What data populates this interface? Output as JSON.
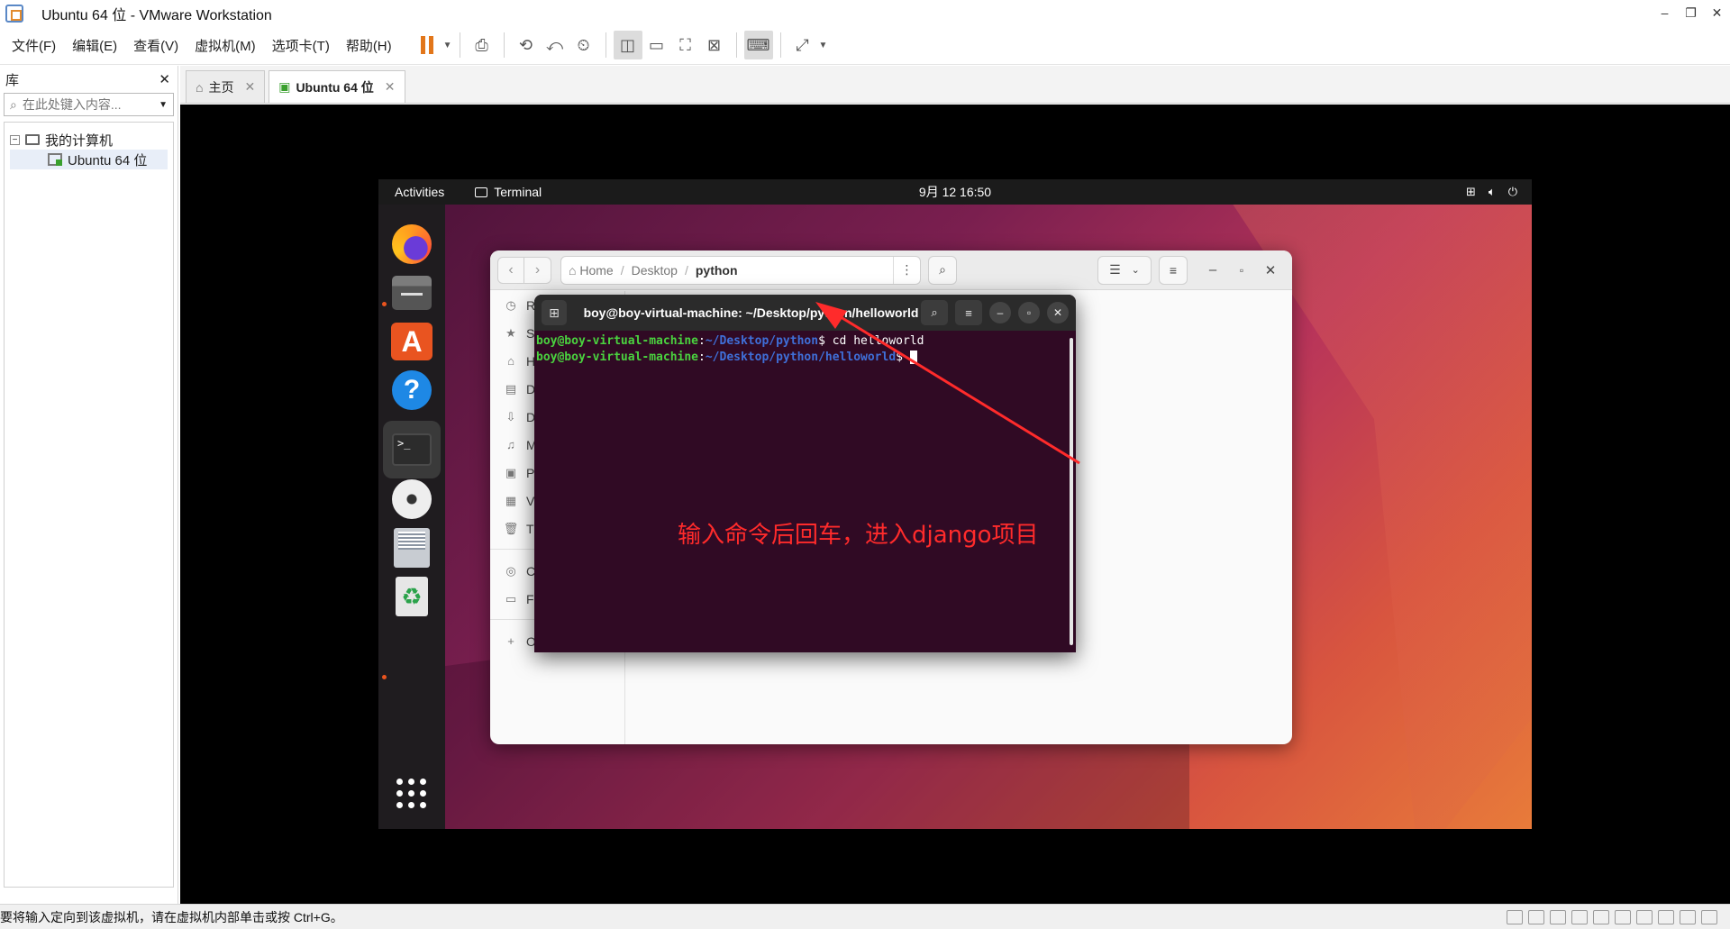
{
  "window": {
    "title": "Ubuntu 64 位 - VMware Workstation",
    "minimize": "–",
    "restore": "❐",
    "close": "✕"
  },
  "menu": [
    "文件(F)",
    "编辑(E)",
    "查看(V)",
    "虚拟机(M)",
    "选项卡(T)",
    "帮助(H)"
  ],
  "library": {
    "title": "库",
    "close": "✕",
    "search_placeholder": "在此处键入内容...",
    "tree_root": "我的计算机",
    "tree_vm": "Ubuntu 64 位"
  },
  "tabs": [
    {
      "label": "主页",
      "active": false
    },
    {
      "label": "Ubuntu 64 位",
      "active": true
    }
  ],
  "statusbar": {
    "message": "要将输入定向到该虚拟机，请在虚拟机内部单击或按 Ctrl+G。"
  },
  "ubuntu": {
    "topbar": {
      "activities": "Activities",
      "app": "Terminal",
      "clock": "9月 12  16:50"
    },
    "files": {
      "path": [
        "Home",
        "Desktop",
        "python"
      ],
      "sidebar": [
        {
          "icon": "recent-icon",
          "label": "R"
        },
        {
          "icon": "star-icon",
          "label": "S"
        },
        {
          "icon": "home-icon",
          "label": "H"
        },
        {
          "icon": "document-icon",
          "label": "D"
        },
        {
          "icon": "download-icon",
          "label": "D"
        },
        {
          "icon": "music-icon",
          "label": "M"
        },
        {
          "icon": "pictures-icon",
          "label": "P"
        },
        {
          "icon": "videos-icon",
          "label": "V"
        },
        {
          "icon": "trash-icon",
          "label": "T"
        },
        {
          "icon": "disc-icon",
          "label": "C"
        },
        {
          "icon": "floppy-icon",
          "label": "F"
        },
        {
          "icon": "plus-icon",
          "label": "O"
        }
      ]
    },
    "terminal": {
      "title": "boy@boy-virtual-machine: ~/Desktop/python/helloworld",
      "lines": [
        {
          "user": "boy@boy-virtual-machine",
          "sep": ":",
          "path": "~/Desktop/python",
          "dollar": "$",
          "cmd": " cd helloworld"
        },
        {
          "user": "boy@boy-virtual-machine",
          "sep": ":",
          "path": "~/Desktop/python/helloworld",
          "dollar": "$",
          "cmd": " "
        }
      ]
    },
    "annotation": "输入命令后回车，进入django项目",
    "colors": {
      "prompt_user": "#4ad23f",
      "prompt_path": "#3f6fd8",
      "terminal_bg": "#300a24",
      "annotation": "#ff2b2b"
    }
  }
}
